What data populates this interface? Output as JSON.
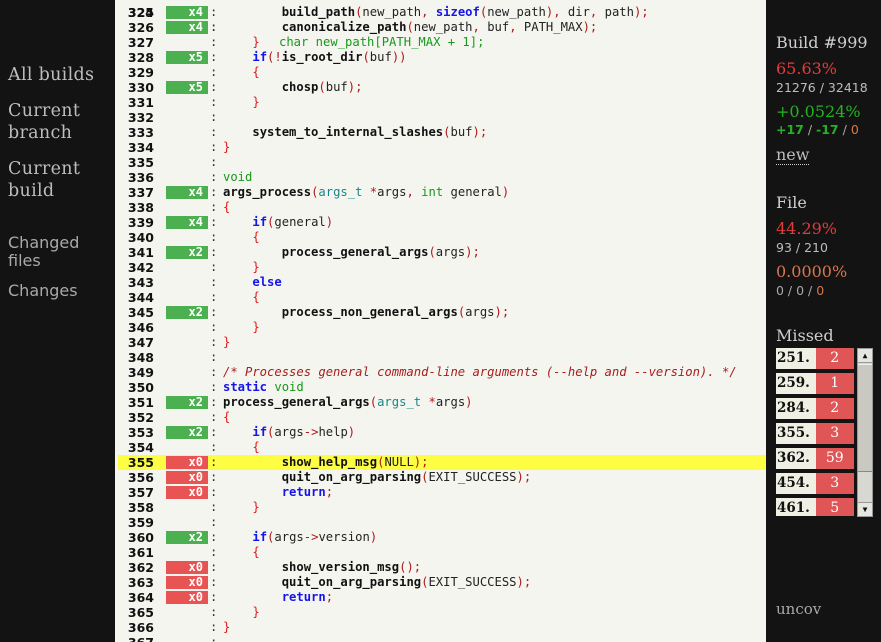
{
  "nav": {
    "all_builds": "All builds",
    "current_branch": [
      "Current",
      "branch"
    ],
    "current_build": [
      "Current",
      "build"
    ],
    "changed_files": [
      "Changed",
      "files"
    ],
    "changes": "Changes"
  },
  "code": {
    "partial_top_line": "char new_path[PATH_MAX + 1];",
    "lines": [
      {
        "n": "325",
        "hits": "x4",
        "status": "covered"
      },
      {
        "n": "326",
        "hits": "x4",
        "status": "covered"
      },
      {
        "n": "327",
        "hits": "",
        "status": "none"
      },
      {
        "n": "328",
        "hits": "x5",
        "status": "covered"
      },
      {
        "n": "329",
        "hits": "",
        "status": "none"
      },
      {
        "n": "330",
        "hits": "x5",
        "status": "covered"
      },
      {
        "n": "331",
        "hits": "",
        "status": "none"
      },
      {
        "n": "332",
        "hits": "",
        "status": "none"
      },
      {
        "n": "333",
        "hits": "",
        "status": "none"
      },
      {
        "n": "334",
        "hits": "",
        "status": "none"
      },
      {
        "n": "335",
        "hits": "",
        "status": "none"
      },
      {
        "n": "336",
        "hits": "",
        "status": "none"
      },
      {
        "n": "337",
        "hits": "x4",
        "status": "covered"
      },
      {
        "n": "338",
        "hits": "",
        "status": "none"
      },
      {
        "n": "339",
        "hits": "x4",
        "status": "covered"
      },
      {
        "n": "340",
        "hits": "",
        "status": "none"
      },
      {
        "n": "341",
        "hits": "x2",
        "status": "covered"
      },
      {
        "n": "342",
        "hits": "",
        "status": "none"
      },
      {
        "n": "343",
        "hits": "",
        "status": "none"
      },
      {
        "n": "344",
        "hits": "",
        "status": "none"
      },
      {
        "n": "345",
        "hits": "x2",
        "status": "covered"
      },
      {
        "n": "346",
        "hits": "",
        "status": "none"
      },
      {
        "n": "347",
        "hits": "",
        "status": "none"
      },
      {
        "n": "348",
        "hits": "",
        "status": "none"
      },
      {
        "n": "349",
        "hits": "",
        "status": "none"
      },
      {
        "n": "350",
        "hits": "",
        "status": "none"
      },
      {
        "n": "351",
        "hits": "x2",
        "status": "covered"
      },
      {
        "n": "352",
        "hits": "",
        "status": "none"
      },
      {
        "n": "353",
        "hits": "x2",
        "status": "covered"
      },
      {
        "n": "354",
        "hits": "",
        "status": "none"
      },
      {
        "n": "355",
        "hits": "x0",
        "status": "missed",
        "highlighted": true
      },
      {
        "n": "356",
        "hits": "x0",
        "status": "missed"
      },
      {
        "n": "357",
        "hits": "x0",
        "status": "missed"
      },
      {
        "n": "358",
        "hits": "",
        "status": "none"
      },
      {
        "n": "359",
        "hits": "",
        "status": "none"
      },
      {
        "n": "360",
        "hits": "x2",
        "status": "covered"
      },
      {
        "n": "361",
        "hits": "",
        "status": "none"
      },
      {
        "n": "362",
        "hits": "x0",
        "status": "missed"
      },
      {
        "n": "363",
        "hits": "x0",
        "status": "missed"
      },
      {
        "n": "364",
        "hits": "x0",
        "status": "missed"
      },
      {
        "n": "365",
        "hits": "",
        "status": "none"
      },
      {
        "n": "366",
        "hits": "",
        "status": "none"
      },
      {
        "n": "367",
        "hits": "",
        "status": "none"
      }
    ],
    "source": [
      [
        [
          2,
          ""
        ],
        [
          0,
          "fn",
          "build_path"
        ],
        [
          0,
          "pn",
          "("
        ],
        [
          0,
          "",
          "new_path"
        ],
        [
          0,
          "pn",
          ", "
        ],
        [
          0,
          "kw",
          "sizeof"
        ],
        [
          0,
          "pn",
          "("
        ],
        [
          0,
          "",
          "new_path"
        ],
        [
          0,
          "pn",
          "), "
        ],
        [
          0,
          "",
          "dir"
        ],
        [
          0,
          "pn",
          ", "
        ],
        [
          0,
          "",
          "path"
        ],
        [
          0,
          "pn",
          ");"
        ]
      ],
      [
        [
          2,
          ""
        ],
        [
          0,
          "fn",
          "canonicalize_path"
        ],
        [
          0,
          "pn",
          "("
        ],
        [
          0,
          "",
          "new_path"
        ],
        [
          0,
          "pn",
          ", "
        ],
        [
          0,
          "",
          "buf"
        ],
        [
          0,
          "pn",
          ", "
        ],
        [
          0,
          "",
          "PATH_MAX"
        ],
        [
          0,
          "pn",
          ");"
        ]
      ],
      [
        [
          1,
          ""
        ],
        [
          0,
          "br",
          "}"
        ]
      ],
      [
        [
          1,
          ""
        ],
        [
          0,
          "kw",
          "if"
        ],
        [
          0,
          "pn",
          "(!"
        ],
        [
          0,
          "fn",
          "is_root_dir"
        ],
        [
          0,
          "pn",
          "("
        ],
        [
          0,
          "",
          "buf"
        ],
        [
          0,
          "pn",
          "))"
        ]
      ],
      [
        [
          1,
          ""
        ],
        [
          0,
          "br",
          "{"
        ]
      ],
      [
        [
          2,
          ""
        ],
        [
          0,
          "fn",
          "chosp"
        ],
        [
          0,
          "pn",
          "("
        ],
        [
          0,
          "",
          "buf"
        ],
        [
          0,
          "pn",
          ");"
        ]
      ],
      [
        [
          1,
          ""
        ],
        [
          0,
          "br",
          "}"
        ]
      ],
      [],
      [
        [
          1,
          ""
        ],
        [
          0,
          "fn",
          "system_to_internal_slashes"
        ],
        [
          0,
          "pn",
          "("
        ],
        [
          0,
          "",
          "buf"
        ],
        [
          0,
          "pn",
          ");"
        ]
      ],
      [
        [
          0,
          "br",
          "}"
        ]
      ],
      [],
      [
        [
          0,
          "ty",
          "void"
        ]
      ],
      [
        [
          0,
          "fn",
          "args_process"
        ],
        [
          0,
          "pn",
          "("
        ],
        [
          0,
          "tt",
          "args_t"
        ],
        [
          0,
          "",
          " "
        ],
        [
          0,
          "pn",
          "*"
        ],
        [
          0,
          "",
          "args"
        ],
        [
          0,
          "pn",
          ", "
        ],
        [
          0,
          "ty",
          "int"
        ],
        [
          0,
          "",
          " general"
        ],
        [
          0,
          "pn",
          ")"
        ]
      ],
      [
        [
          0,
          "br",
          "{"
        ]
      ],
      [
        [
          1,
          ""
        ],
        [
          0,
          "kw",
          "if"
        ],
        [
          0,
          "pn",
          "("
        ],
        [
          0,
          "",
          "general"
        ],
        [
          0,
          "pn",
          ")"
        ]
      ],
      [
        [
          1,
          ""
        ],
        [
          0,
          "br",
          "{"
        ]
      ],
      [
        [
          2,
          ""
        ],
        [
          0,
          "fn",
          "process_general_args"
        ],
        [
          0,
          "pn",
          "("
        ],
        [
          0,
          "",
          "args"
        ],
        [
          0,
          "pn",
          ");"
        ]
      ],
      [
        [
          1,
          ""
        ],
        [
          0,
          "br",
          "}"
        ]
      ],
      [
        [
          1,
          ""
        ],
        [
          0,
          "kw",
          "else"
        ]
      ],
      [
        [
          1,
          ""
        ],
        [
          0,
          "br",
          "{"
        ]
      ],
      [
        [
          2,
          ""
        ],
        [
          0,
          "fn",
          "process_non_general_args"
        ],
        [
          0,
          "pn",
          "("
        ],
        [
          0,
          "",
          "args"
        ],
        [
          0,
          "pn",
          ");"
        ]
      ],
      [
        [
          1,
          ""
        ],
        [
          0,
          "br",
          "}"
        ]
      ],
      [
        [
          0,
          "br",
          "}"
        ]
      ],
      [],
      [
        [
          0,
          "cm",
          "/* Processes general command-line arguments (--help and --version). */"
        ]
      ],
      [
        [
          0,
          "kw",
          "static"
        ],
        [
          0,
          "",
          " "
        ],
        [
          0,
          "ty",
          "void"
        ]
      ],
      [
        [
          0,
          "fn",
          "process_general_args"
        ],
        [
          0,
          "pn",
          "("
        ],
        [
          0,
          "tt",
          "args_t"
        ],
        [
          0,
          "",
          " "
        ],
        [
          0,
          "pn",
          "*"
        ],
        [
          0,
          "",
          "args"
        ],
        [
          0,
          "pn",
          ")"
        ]
      ],
      [
        [
          0,
          "br",
          "{"
        ]
      ],
      [
        [
          1,
          ""
        ],
        [
          0,
          "kw",
          "if"
        ],
        [
          0,
          "pn",
          "("
        ],
        [
          0,
          "",
          "args"
        ],
        [
          0,
          "pn",
          "->"
        ],
        [
          0,
          "",
          "help"
        ],
        [
          0,
          "pn",
          ")"
        ]
      ],
      [
        [
          1,
          ""
        ],
        [
          0,
          "br",
          "{"
        ]
      ],
      [
        [
          2,
          ""
        ],
        [
          0,
          "fn",
          "show_help_msg"
        ],
        [
          0,
          "pn",
          "("
        ],
        [
          0,
          "",
          "NULL"
        ],
        [
          0,
          "pn",
          ");"
        ]
      ],
      [
        [
          2,
          ""
        ],
        [
          0,
          "fn",
          "quit_on_arg_parsing"
        ],
        [
          0,
          "pn",
          "("
        ],
        [
          0,
          "",
          "EXIT_SUCCESS"
        ],
        [
          0,
          "pn",
          ");"
        ]
      ],
      [
        [
          2,
          ""
        ],
        [
          0,
          "kw",
          "return"
        ],
        [
          0,
          "pn",
          ";"
        ]
      ],
      [
        [
          1,
          ""
        ],
        [
          0,
          "br",
          "}"
        ]
      ],
      [],
      [
        [
          1,
          ""
        ],
        [
          0,
          "kw",
          "if"
        ],
        [
          0,
          "pn",
          "("
        ],
        [
          0,
          "",
          "args"
        ],
        [
          0,
          "pn",
          "->"
        ],
        [
          0,
          "",
          "version"
        ],
        [
          0,
          "pn",
          ")"
        ]
      ],
      [
        [
          1,
          ""
        ],
        [
          0,
          "br",
          "{"
        ]
      ],
      [
        [
          2,
          ""
        ],
        [
          0,
          "fn",
          "show_version_msg"
        ],
        [
          0,
          "pn",
          "();"
        ]
      ],
      [
        [
          2,
          ""
        ],
        [
          0,
          "fn",
          "quit_on_arg_parsing"
        ],
        [
          0,
          "pn",
          "("
        ],
        [
          0,
          "",
          "EXIT_SUCCESS"
        ],
        [
          0,
          "pn",
          ");"
        ]
      ],
      [
        [
          2,
          ""
        ],
        [
          0,
          "kw",
          "return"
        ],
        [
          0,
          "pn",
          ";"
        ]
      ],
      [
        [
          1,
          ""
        ],
        [
          0,
          "br",
          "}"
        ]
      ],
      [
        [
          0,
          "br",
          "}"
        ]
      ],
      []
    ]
  },
  "build": {
    "title": "Build #999",
    "coverage_pct": "65.63%",
    "covered_total": "21276 / 32418",
    "delta_pct": "+0.0524%",
    "delta_plus": "+17",
    "delta_minus": "-17",
    "delta_zero": "0",
    "sep": " / ",
    "new_link": "new"
  },
  "file": {
    "title": "File",
    "coverage_pct": "44.29%",
    "covered_total": "93 / 210",
    "delta_pct": "0.0000%",
    "delta_a": "0",
    "delta_b": "0",
    "delta_c": "0",
    "sep": " / "
  },
  "missed": {
    "title": "Missed",
    "items": [
      {
        "line": "251.",
        "count": "2"
      },
      {
        "line": "259.",
        "count": "1"
      },
      {
        "line": "284.",
        "count": "2"
      },
      {
        "line": "355.",
        "count": "3"
      },
      {
        "line": "362.",
        "count": "59"
      },
      {
        "line": "454.",
        "count": "3"
      },
      {
        "line": "461.",
        "count": "5"
      }
    ],
    "scroll_up_icon": "▲",
    "scroll_down_icon": "▼"
  },
  "footer": "uncov",
  "colors": {
    "covered": "#4caf50",
    "missed": "#e85353",
    "highlight": "#fdfd44",
    "red_pct": "#e23c3c",
    "green_pct": "#22b322",
    "orange_pct": "#d8764e"
  }
}
